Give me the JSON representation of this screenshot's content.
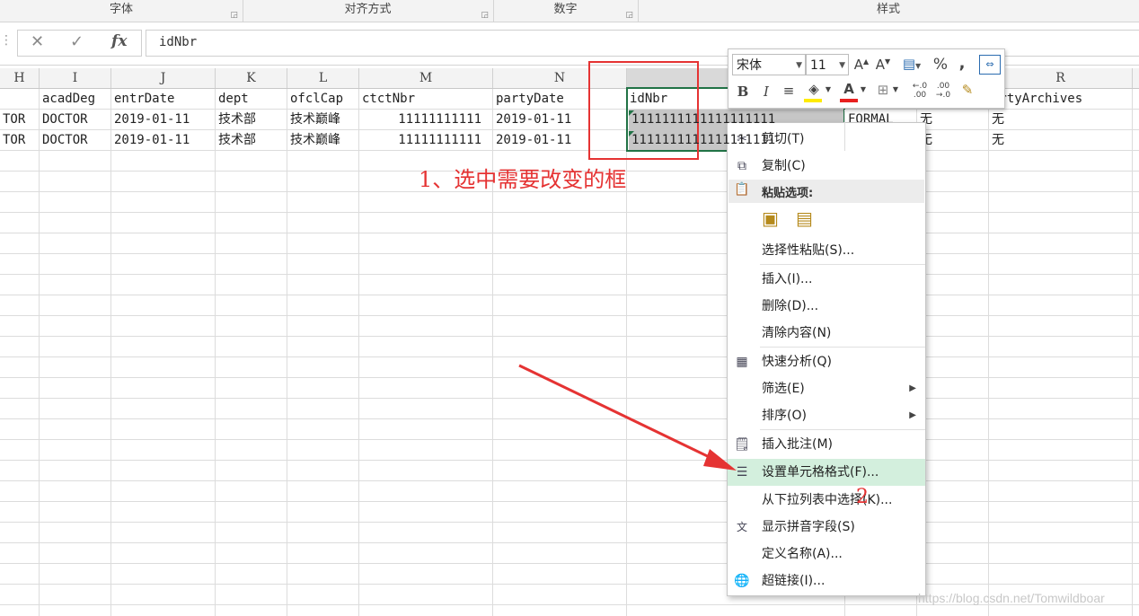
{
  "ribbon": {
    "groups": [
      "字体",
      "对齐方式",
      "数字",
      "样式"
    ]
  },
  "formula_bar": {
    "cancel_glyph": "✕",
    "enter_glyph": "✓",
    "fx_label": "fx",
    "value": "idNbr"
  },
  "columns": [
    "H",
    "I",
    "J",
    "K",
    "L",
    "M",
    "N",
    "",
    "",
    "",
    "R"
  ],
  "rows": [
    {
      "H": "",
      "I": "acadDeg",
      "J": "entrDate",
      "K": "dept",
      "L": "ofclCap",
      "M": "ctctNbr",
      "N": "partyDate",
      "O": "idNbr",
      "R": "artyArchives"
    },
    {
      "H": "TOR",
      "I": "DOCTOR",
      "J": "2019-01-11",
      "K": "技术部",
      "L": "技术巅峰",
      "M": "11111111111",
      "N": "2019-01-11",
      "O": "1111111111111111111",
      "P": "FORMAL",
      "Q": "无",
      "R": "无"
    },
    {
      "H": "TOR",
      "I": "DOCTOR",
      "J": "2019-01-11",
      "K": "技术部",
      "L": "技术巅峰",
      "M": "11111111111",
      "N": "2019-01-11",
      "O": "1111111111111111111",
      "P": "",
      "Q": "无",
      "R": "无"
    }
  ],
  "mini_toolbar": {
    "font_name": "宋体",
    "font_size": "11",
    "bold": "B",
    "italic": "I",
    "percent": "%",
    "comma": ","
  },
  "context_menu": {
    "items": [
      {
        "label": "剪切(T)",
        "icon": "scissors-icon"
      },
      {
        "label": "复制(C)",
        "icon": "copy-icon"
      },
      {
        "label": "粘贴选项:",
        "icon": "paste-icon"
      },
      {
        "label": "选择性粘贴(S)...",
        "icon": ""
      },
      {
        "label": "插入(I)...",
        "icon": ""
      },
      {
        "label": "删除(D)...",
        "icon": ""
      },
      {
        "label": "清除内容(N)",
        "icon": ""
      },
      {
        "label": "快速分析(Q)",
        "icon": "quick-analysis-icon"
      },
      {
        "label": "筛选(E)",
        "icon": "",
        "submenu": "▶"
      },
      {
        "label": "排序(O)",
        "icon": "",
        "submenu": "▶"
      },
      {
        "label": "插入批注(M)",
        "icon": "comment-icon"
      },
      {
        "label": "设置单元格格式(F)...",
        "icon": "format-cells-icon"
      },
      {
        "label": "从下拉列表中选择(K)...",
        "icon": ""
      },
      {
        "label": "显示拼音字段(S)",
        "icon": "pinyin-icon"
      },
      {
        "label": "定义名称(A)...",
        "icon": ""
      },
      {
        "label": "超链接(I)...",
        "icon": "hyperlink-icon"
      }
    ],
    "highlighted_color": "#d3efdd"
  },
  "annotations": {
    "step1": "1、选中需要改变的框",
    "step2": "2",
    "color": "#e53333"
  },
  "watermark": "https://blog.csdn.net/Tomwildboar"
}
